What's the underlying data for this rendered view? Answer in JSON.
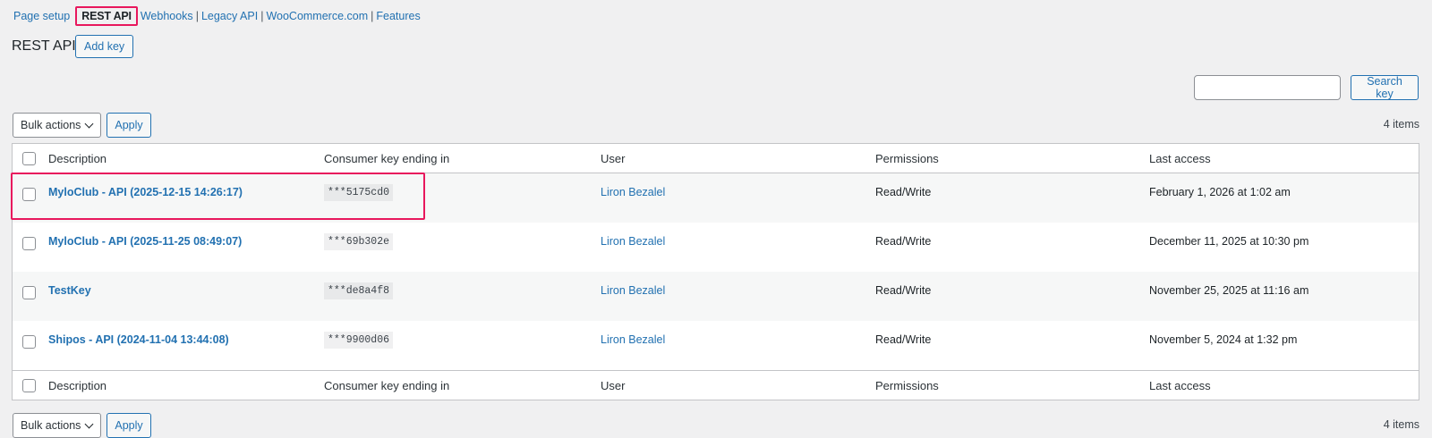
{
  "nav": {
    "page_setup": "Page setup",
    "rest_api": "REST API",
    "webhooks": "Webhooks",
    "legacy_api": "Legacy API",
    "woocommerce": "WooCommerce.com",
    "features": "Features",
    "sep": "|"
  },
  "page": {
    "title": "REST API",
    "add_key": "Add key"
  },
  "search": {
    "placeholder": "",
    "button": "Search key"
  },
  "tablenav_top": {
    "bulk_actions": "Bulk actions",
    "apply": "Apply",
    "count": "4 items"
  },
  "tablenav_bottom": {
    "bulk_actions": "Bulk actions",
    "apply": "Apply",
    "count": "4 items"
  },
  "columns": {
    "description": "Description",
    "consumer_key": "Consumer key ending in",
    "user": "User",
    "permissions": "Permissions",
    "last_access": "Last access"
  },
  "rows": [
    {
      "description": "MyloClub - API (2025-12-15 14:26:17)",
      "key": "***5175cd0",
      "user": "Liron Bezalel",
      "permissions": "Read/Write",
      "last_access": "February 1, 2026 at 1:02 am"
    },
    {
      "description": "MyloClub - API (2025-11-25 08:49:07)",
      "key": "***69b302e",
      "user": "Liron Bezalel",
      "permissions": "Read/Write",
      "last_access": "December 11, 2025 at 10:30 pm"
    },
    {
      "description": "TestKey",
      "key": "***de8a4f8",
      "user": "Liron Bezalel",
      "permissions": "Read/Write",
      "last_access": "November 25, 2025 at 11:16 am"
    },
    {
      "description": "Shipos - API (2024-11-04 13:44:08)",
      "key": "***9900d06",
      "user": "Liron Bezalel",
      "permissions": "Read/Write",
      "last_access": "November 5, 2024 at 1:32 pm"
    }
  ],
  "colors": {
    "link": "#2271b1",
    "highlight": "#e8175d",
    "background": "#f0f0f1"
  }
}
